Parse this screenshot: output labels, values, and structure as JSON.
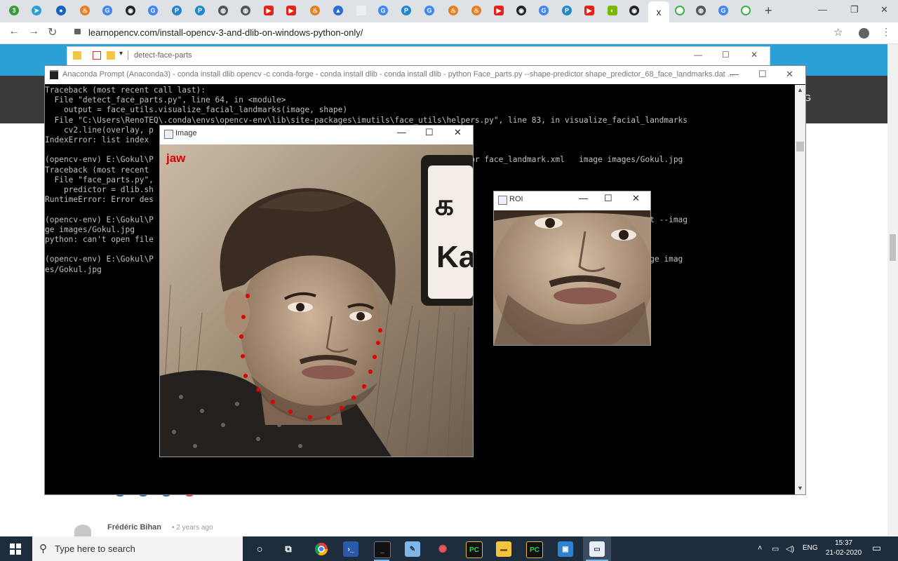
{
  "browser": {
    "url": "learnopencv.com/install-opencv-3-and-dlib-on-windows-python-only/",
    "active_tab_close": "x",
    "new_tab": "+"
  },
  "page": {
    "comment_author": "Frédéric Bihan",
    "comment_time": "• 2 years ago",
    "header_letter": "G"
  },
  "explorer": {
    "title": "detect-face-parts"
  },
  "console": {
    "title": "Anaconda Prompt (Anaconda3) - conda install dlib opencv -c conda-forge - conda install dlib - conda install dlib - python Face_parts.py --shape-predictor shape_predictor_68_face_landmarks.dat ...",
    "lines": [
      "Traceback (most recent call last):",
      "  File \"detect_face_parts.py\", line 64, in <module>",
      "    output = face_utils.visualize_facial_landmarks(image, shape)",
      "  File \"C:\\Users\\RenoTEQ\\.conda\\envs\\opencv-env\\lib\\site-packages\\imutils\\face_utils\\helpers.py\", line 83, in visualize_facial_landmarks",
      "    cv2.line(overlay, p",
      "IndexError: list index",
      "",
      "(opencv-env) E:\\Gokul\\P                                                        ape-predictor face_landmark.xml   image images/Gokul.jpg",
      "Traceback (most recent",
      "  File \"face_parts.py\",",
      "    predictor = dlib.sh",
      "RuntimeError: Error des",
      "",
      "(opencv-env) E:\\Gokul\\P                                                        py -                       e_68_face_landmarks.dat --imag",
      "ge images/Gokul.jpg",
      "python: can't open file",
      "",
      "(opencv-env) E:\\Gokul\\P                                                        ape-                       ce_landmarks.dat --image imag",
      "es/Gokul.jpg"
    ]
  },
  "image_window": {
    "title": "Image",
    "overlay_label": "jaw",
    "jaw_dot_color": "#e00000"
  },
  "roi_window": {
    "title": "ROI"
  },
  "taskbar": {
    "search_placeholder": "Type here to search",
    "language": "ENG",
    "time": "15:37",
    "date": "21-02-2020"
  }
}
